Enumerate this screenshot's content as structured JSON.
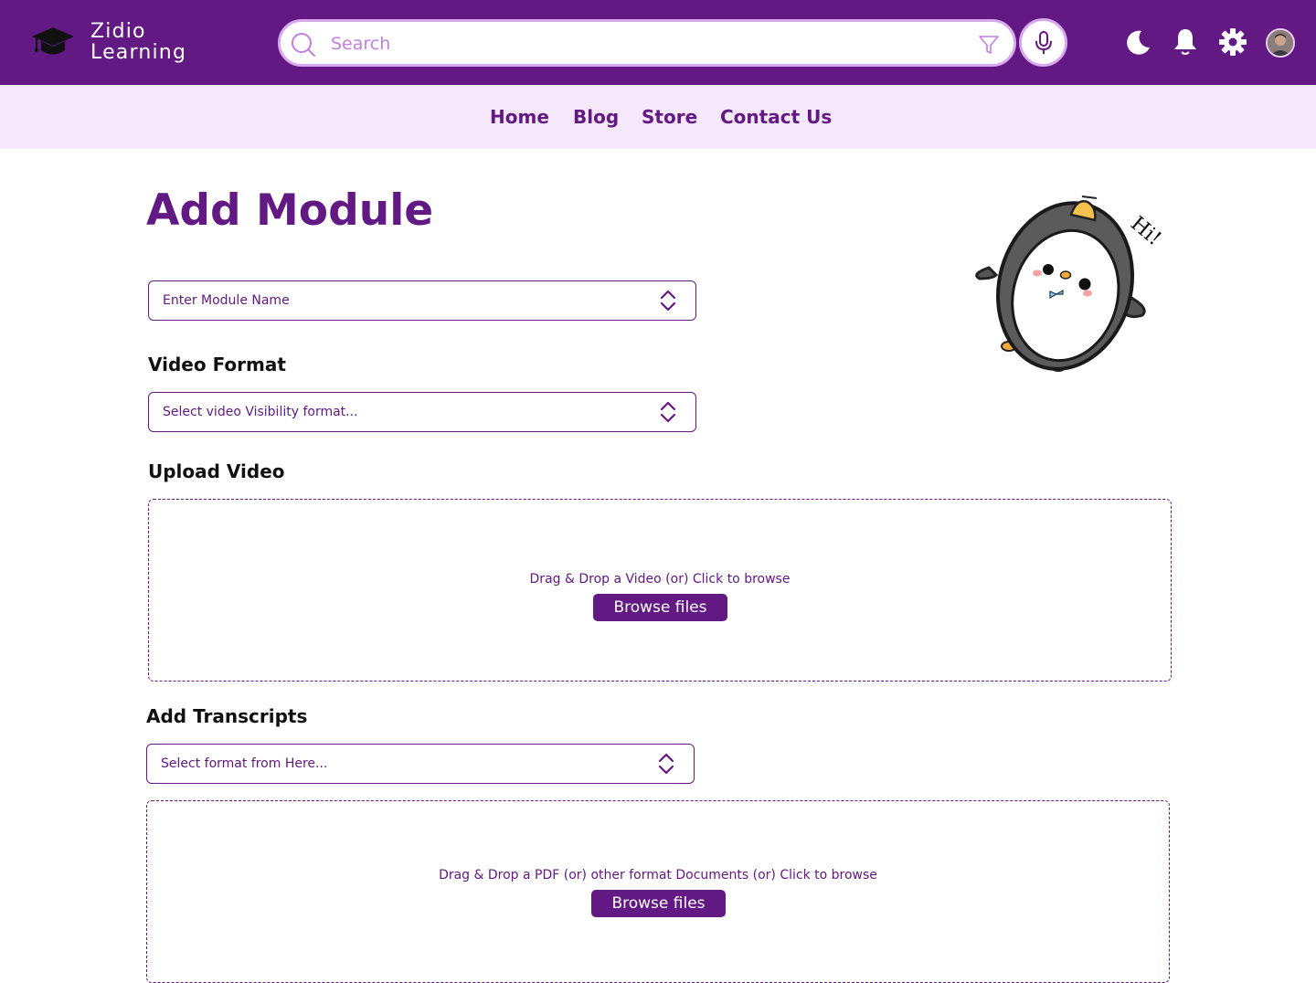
{
  "app": {
    "brand_line1": "Zidio",
    "brand_line2": "Learning"
  },
  "header": {
    "search_placeholder": "Search",
    "icons": [
      "graduation-cap-icon",
      "search-icon",
      "filter-icon",
      "microphone-icon",
      "moon-icon",
      "bell-icon",
      "gear-icon",
      "avatar"
    ]
  },
  "nav": {
    "items": [
      {
        "label": "Home"
      },
      {
        "label": "Blog"
      },
      {
        "label": "Store"
      },
      {
        "label": "Contact Us"
      }
    ]
  },
  "main": {
    "title": "Add Module",
    "module_name_placeholder": "Enter Module Name",
    "video_format_label": "Video Format",
    "video_format_placeholder": "Select video Visibility format...",
    "upload_video_label": "Upload Video",
    "video_drop_text": "Drag & Drop a Video (or) Click to browse",
    "video_browse_label": "Browse files",
    "transcripts_label": "Add Transcripts",
    "transcript_format_placeholder": "Select format from Here...",
    "doc_drop_text": "Drag & Drop a PDF (or) other format Documents (or) Click to browse",
    "doc_browse_label": "Browse files"
  },
  "mascot": {
    "greeting": "Hi!"
  },
  "colors": {
    "primary": "#621983",
    "nav_bg": "#f6e8fb",
    "accent_light": "#d9a9ee"
  }
}
